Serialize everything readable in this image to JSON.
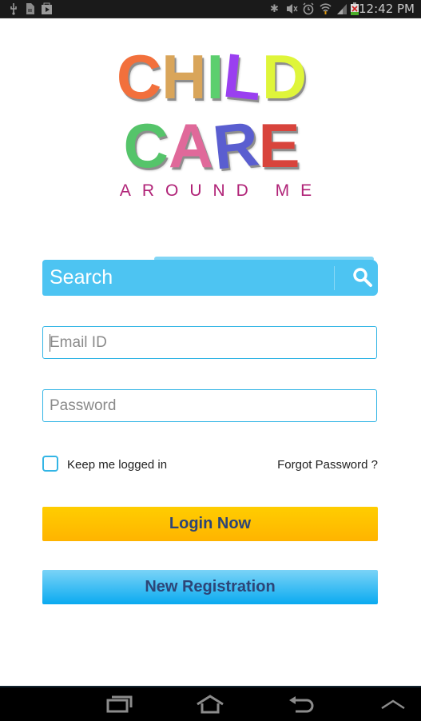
{
  "status_bar": {
    "time": "12:42 PM",
    "left_icons": [
      "usb-icon",
      "sd-card-icon",
      "play-store-icon"
    ],
    "right_icons": [
      "bluetooth-icon",
      "mute-icon",
      "alarm-icon",
      "wifi-icon",
      "signal-icon",
      "battery-icon"
    ]
  },
  "logo": {
    "line1": [
      "C",
      "H",
      "I",
      "L",
      "D"
    ],
    "line1_colors": [
      "#f2703c",
      "#d9a55a",
      "#5ccf6e",
      "#9a3ff0",
      "#dff53a"
    ],
    "line2": [
      "C",
      "A",
      "R",
      "E"
    ],
    "line2_colors": [
      "#55c46a",
      "#e0699a",
      "#5a5ed0",
      "#d8443c"
    ],
    "subtitle": "AROUND ME"
  },
  "search": {
    "placeholder": "Search",
    "icon": "search-icon",
    "color": "#4dc4f2"
  },
  "form": {
    "email_placeholder": "Email ID",
    "email_value": "",
    "password_placeholder": "Password",
    "password_value": "",
    "keep_logged_in_label": "Keep me logged in",
    "keep_logged_in_checked": false,
    "forgot_password_label": "Forgot Password ?"
  },
  "buttons": {
    "login_label": "Login Now",
    "registration_label": "New Registration"
  },
  "nav_bar": {
    "icons": [
      "recent-apps-icon",
      "home-icon",
      "back-icon",
      "menu-up-icon"
    ]
  }
}
